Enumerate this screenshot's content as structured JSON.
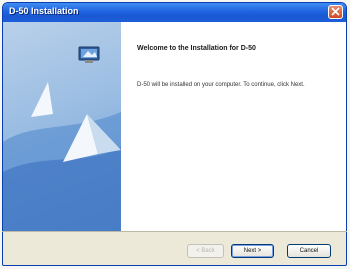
{
  "window": {
    "title": "D-50 Installation"
  },
  "icons": {
    "close": "close-icon",
    "app": "monitor-icon"
  },
  "content": {
    "heading": "Welcome to the Installation for D-50",
    "body": "D-50 will be installed on your computer. To continue, click Next."
  },
  "buttons": {
    "back": "< Back",
    "next": "Next >",
    "cancel": "Cancel"
  },
  "colors": {
    "titlebar": "#1f63df",
    "close": "#cf4a25",
    "panel": "#9dbfe3"
  }
}
